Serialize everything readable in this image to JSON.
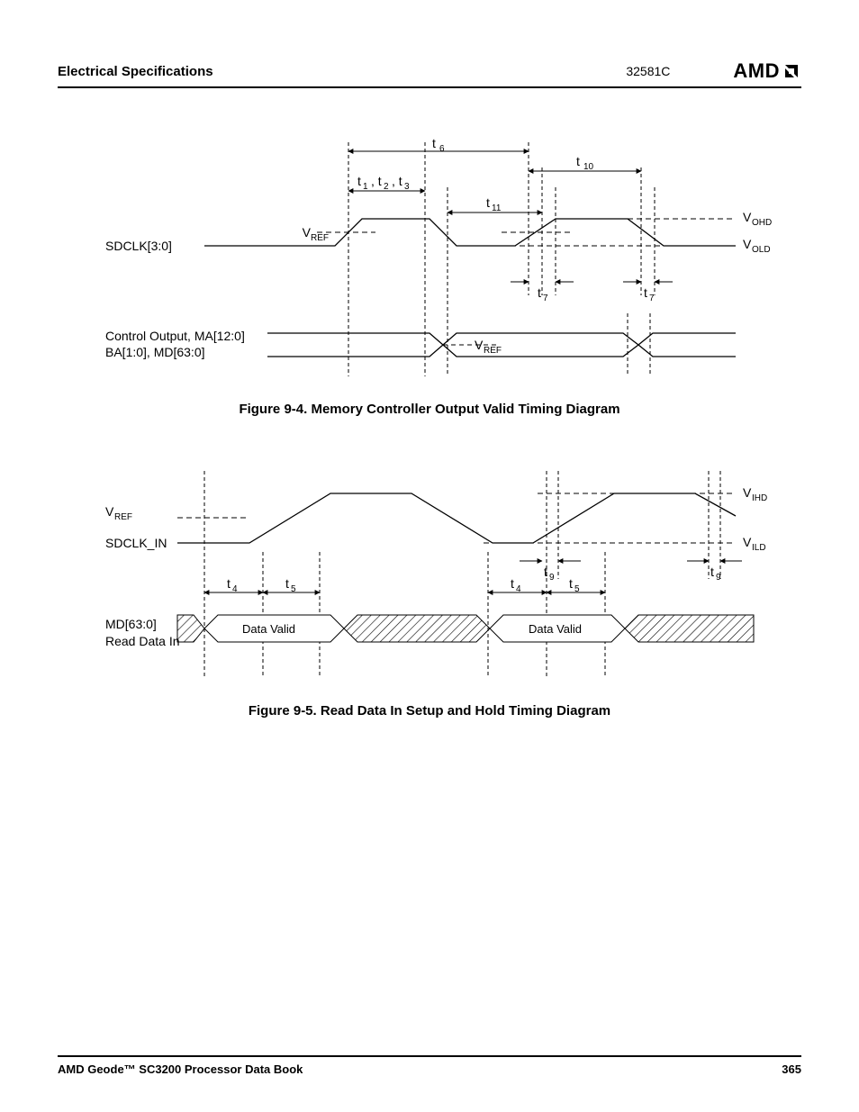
{
  "header": {
    "section": "Electrical Specifications",
    "doc_id": "32581C",
    "logo": "AMD"
  },
  "figure1": {
    "caption": "Figure 9-4.  Memory Controller Output Valid Timing Diagram",
    "labels": {
      "sdclk": "SDCLK[3:0]",
      "ctrl1": "Control Output, MA[12:0]",
      "ctrl2": "BA[1:0], MD[63:0]",
      "vref": "VREF",
      "vohd": "VOHD",
      "vold": "VOLD",
      "t1": "t1, t2, t3",
      "t6": "t6",
      "t7": "t7",
      "t10": "t10",
      "t11": "t11"
    }
  },
  "figure2": {
    "caption": "Figure 9-5.  Read Data In Setup and Hold Timing Diagram",
    "labels": {
      "vref": "VREF",
      "sdclk_in": "SDCLK_IN",
      "md": "MD[63:0]",
      "rdi": "Read Data In",
      "data_valid": "Data Valid",
      "vihd": "VIHD",
      "vild": "VILD",
      "t4": "t4",
      "t5": "t5",
      "t9": "t9"
    }
  },
  "footer": {
    "book": "AMD Geode™ SC3200 Processor Data Book",
    "page": "365"
  }
}
